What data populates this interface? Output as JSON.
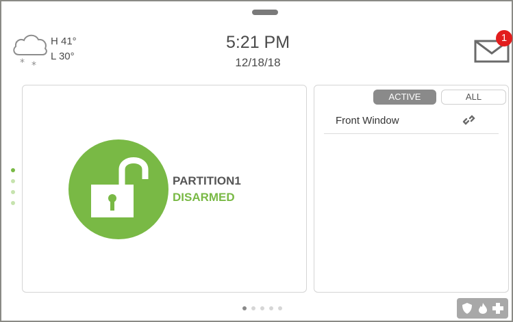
{
  "header": {
    "weather": {
      "icon": "snow-cloud-icon",
      "high": "H 41°",
      "low": "L 30°"
    },
    "time": "5:21 PM",
    "date": "12/18/18",
    "messages": {
      "icon": "envelope-icon",
      "unread_count": "1",
      "badge_color": "#e21d1d"
    }
  },
  "partition": {
    "name": "PARTITION1",
    "status": "DISARMED",
    "status_color": "#79b945",
    "icon": "unlocked-padlock-icon"
  },
  "sensors": {
    "tabs": [
      {
        "label": "ACTIVE",
        "selected": true
      },
      {
        "label": "ALL",
        "selected": false
      }
    ],
    "items": [
      {
        "name": "Front Window",
        "icon": "broken-link-icon"
      }
    ]
  },
  "pager": {
    "page_count": 5,
    "current_page": 1,
    "side_dot_count": 4,
    "side_dot_active": 1
  },
  "emergency": {
    "icons": [
      "shield-icon",
      "fire-icon",
      "medical-cross-icon"
    ]
  },
  "colors": {
    "accent_green": "#79b945",
    "tab_active_bg": "#8a8a8a",
    "frame_border": "#8a8a85"
  }
}
